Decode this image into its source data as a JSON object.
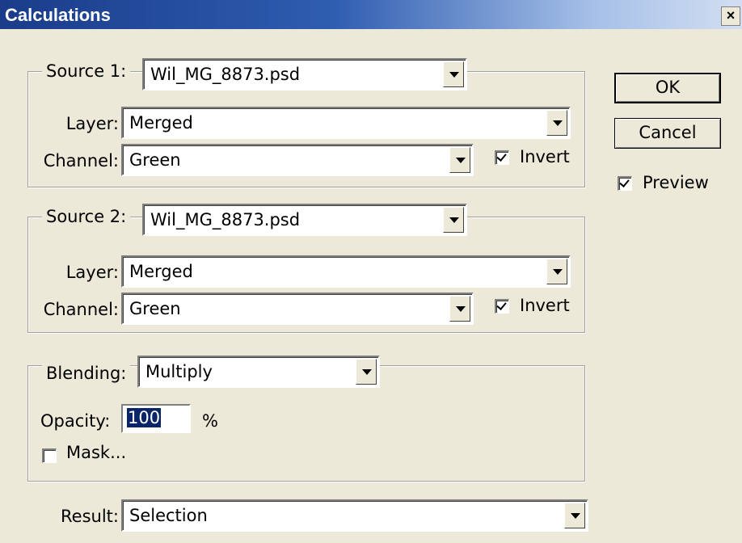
{
  "window": {
    "title": "Calculations",
    "close_glyph": "×"
  },
  "source1": {
    "legend": "Source 1:",
    "file": "Wil_MG_8873.psd",
    "layer_label": "Layer:",
    "layer": "Merged",
    "channel_label": "Channel:",
    "channel": "Green",
    "invert_label": "Invert",
    "invert_checked": true
  },
  "source2": {
    "legend": "Source 2:",
    "file": "Wil_MG_8873.psd",
    "layer_label": "Layer:",
    "layer": "Merged",
    "channel_label": "Channel:",
    "channel": "Green",
    "invert_label": "Invert",
    "invert_checked": true
  },
  "blending": {
    "legend": "Blending:",
    "mode": "Multiply",
    "opacity_label": "Opacity:",
    "opacity_value": "100",
    "opacity_unit": "%",
    "mask_label": "Mask...",
    "mask_checked": false
  },
  "result": {
    "label": "Result:",
    "value": "Selection"
  },
  "buttons": {
    "ok": "OK",
    "cancel": "Cancel"
  },
  "preview": {
    "label": "Preview",
    "checked": true
  },
  "icons": [
    "close-icon",
    "dropdown-arrow-icon",
    "checkmark-icon"
  ]
}
